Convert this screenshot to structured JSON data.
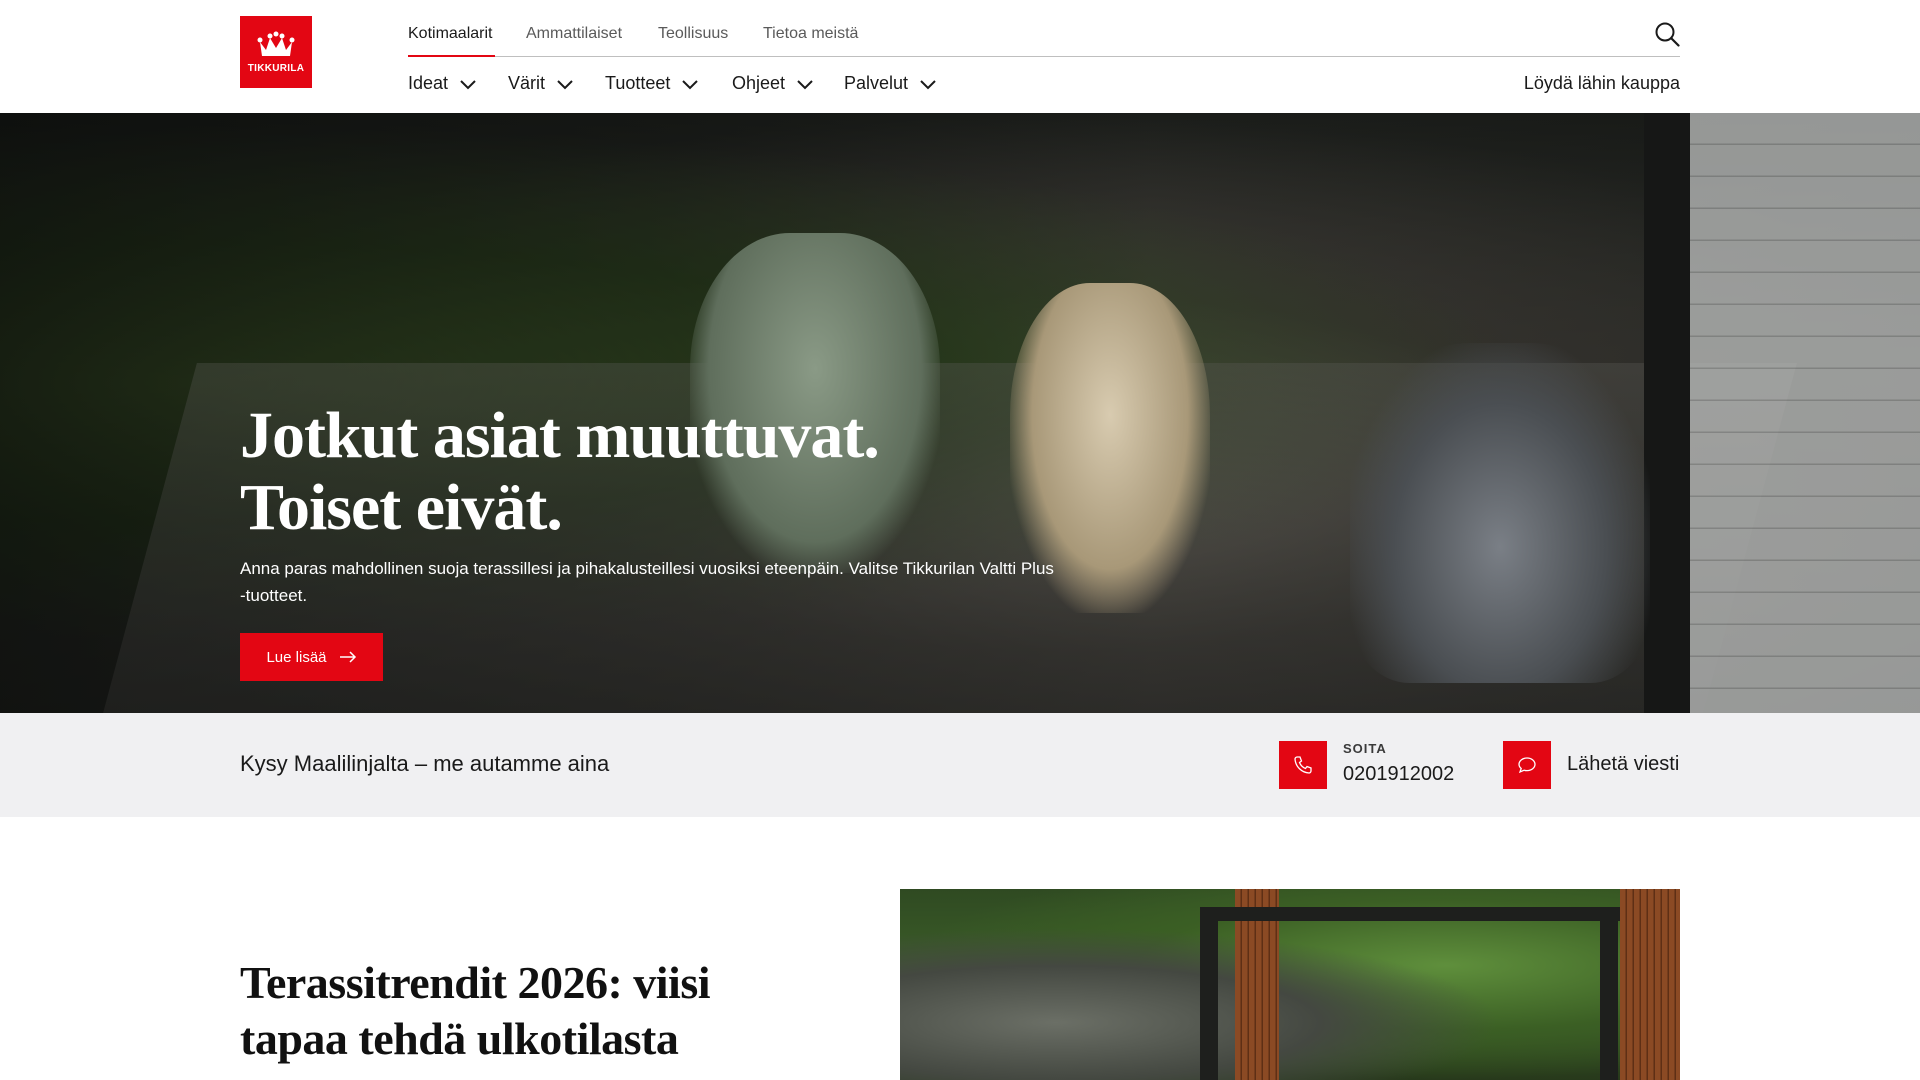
{
  "brand": {
    "logo_text": "TIKKURILA",
    "accent_color": "#e30613"
  },
  "topnav": {
    "items": [
      {
        "label": "Kotimaalarit",
        "active": true
      },
      {
        "label": "Ammattilaiset",
        "active": false
      },
      {
        "label": "Teollisuus",
        "active": false
      },
      {
        "label": "Tietoa meistä",
        "active": false
      }
    ],
    "search_icon": "search-icon"
  },
  "mainnav": {
    "items": [
      {
        "label": "Ideat"
      },
      {
        "label": "Värit"
      },
      {
        "label": "Tuotteet"
      },
      {
        "label": "Ohjeet"
      },
      {
        "label": "Palvelut"
      }
    ],
    "store_link": "Löydä lähin kauppa"
  },
  "hero": {
    "title_line1": "Jotkut asiat muuttuvat.",
    "title_line2": "Toiset eivät.",
    "text": "Anna paras mahdollinen suoja terassillesi ja pihakalusteillesi vuosiksi eteenpäin. Valitse Tikkurilan Valtti Plus -tuotteet.",
    "button_label": "Lue lisää"
  },
  "helpbar": {
    "title": "Kysy Maalilinjalta – me autamme aina",
    "call_label": "SOITA",
    "call_number": "0201912002",
    "message_label": "Lähetä viesti"
  },
  "article": {
    "title": "Terassitrendit 2026: viisi tapaa tehdä ulkotilasta"
  }
}
